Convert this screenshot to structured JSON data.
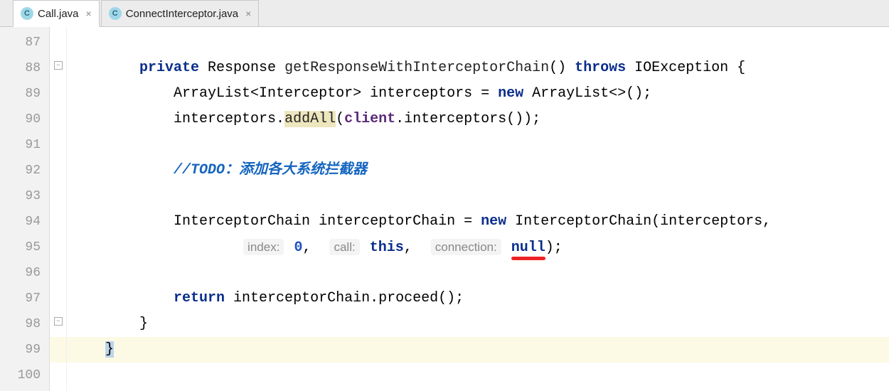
{
  "tabs": [
    {
      "icon": "C",
      "label": "Call.java",
      "active": true
    },
    {
      "icon": "C",
      "label": "ConnectInterceptor.java",
      "active": false
    }
  ],
  "gutter": [
    "87",
    "88",
    "89",
    "90",
    "91",
    "92",
    "93",
    "94",
    "95",
    "96",
    "97",
    "98",
    "99",
    "100"
  ],
  "code": {
    "l88_kw1": "private",
    "l88_type": " Response ",
    "l88_method": "getResponseWithInterceptorChain",
    "l88_paren": "() ",
    "l88_kw2": "throws",
    "l88_rest": " IOException {",
    "l89_a": "ArrayList<Interceptor> interceptors = ",
    "l89_kw": "new",
    "l89_b": " ArrayList<>();",
    "l90_a": "interceptors.",
    "l90_hl": "addAll",
    "l90_b": "(",
    "l90_field": "client",
    "l90_c": ".interceptors());",
    "l92_comment": "//TODO：添加各大系统拦截器",
    "l94_a": "InterceptorChain interceptorChain = ",
    "l94_kw": "new",
    "l94_b": " InterceptorChain(interceptors,",
    "l95_h1": "index:",
    "l95_v1": "0",
    "l95_comma1": ",  ",
    "l95_h2": "call:",
    "l95_v2": "this",
    "l95_comma2": ",  ",
    "l95_h3": "connection:",
    "l95_v3": "null",
    "l95_end": ");",
    "l97_kw": "return",
    "l97_rest": " interceptorChain.proceed();",
    "l98": "}",
    "l99": "}"
  }
}
